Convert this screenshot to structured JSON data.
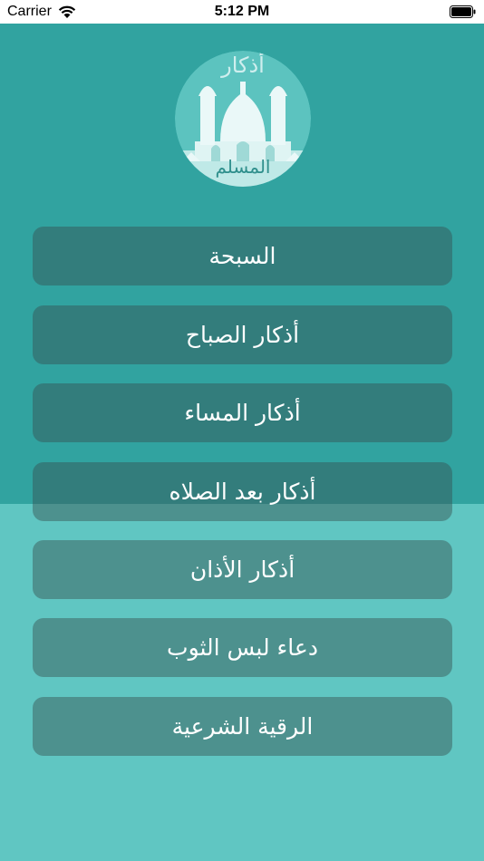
{
  "status_bar": {
    "carrier": "Carrier",
    "time": "5:12 PM"
  },
  "logo": {
    "title_top": "أذكار",
    "title_bottom": "المسلم"
  },
  "menu": [
    {
      "label": "السبحة"
    },
    {
      "label": "أذكار الصباح"
    },
    {
      "label": "أذكار المساء"
    },
    {
      "label": "أذكار بعد الصلاه"
    },
    {
      "label": "أذكار الأذان"
    },
    {
      "label": "دعاء لبس الثوب"
    },
    {
      "label": "الرقية الشرعية"
    }
  ],
  "colors": {
    "top_background": "#31a3a0",
    "bottom_background": "#60c6c2",
    "button_background": "rgba(55,80,80,0.45)",
    "button_text": "#ffffff"
  }
}
